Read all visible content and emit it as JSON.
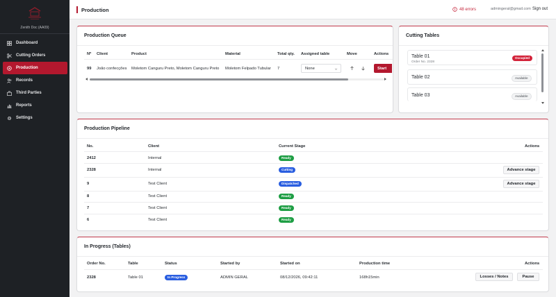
{
  "sidebar": {
    "org": "Zenith Doc (AA09)",
    "items": [
      {
        "label": "Dashboard",
        "icon": "grid-icon"
      },
      {
        "label": "Cutting Orders",
        "icon": "scissors-icon"
      },
      {
        "label": "Production",
        "icon": "production-icon"
      },
      {
        "label": "Records",
        "icon": "users-icon"
      },
      {
        "label": "Third Parties",
        "icon": "briefcase-icon"
      },
      {
        "label": "Reports",
        "icon": "chart-icon"
      },
      {
        "label": "Settings",
        "icon": "gear-icon"
      }
    ]
  },
  "header": {
    "title": "Production",
    "errors": "48 errors",
    "email": "admingeral@gmail.com",
    "signout": "Sign out"
  },
  "queue": {
    "title": "Production Queue",
    "columns": [
      "Nº",
      "Client",
      "Product",
      "Material",
      "Total qty.",
      "Assigned table",
      "Move",
      "Actions"
    ],
    "row": {
      "no": "99",
      "client": "João confecções",
      "product": "Moletom Canguru Preto, Moletom Canguru Preto",
      "material": "Moletom Felpado Tubular",
      "qty": "7",
      "table": "None",
      "action": "Start"
    }
  },
  "tables": {
    "title": "Cutting Tables",
    "items": [
      {
        "name": "Table 01",
        "order": "Order No. 2328",
        "status": "Occupied"
      },
      {
        "name": "Table 02",
        "order": "",
        "status": "Available"
      },
      {
        "name": "Table 03",
        "order": "",
        "status": "Available"
      }
    ]
  },
  "pipeline": {
    "title": "Production Pipeline",
    "columns": [
      "No.",
      "Client",
      "Current Stage",
      "Actions"
    ],
    "rows": [
      {
        "no": "2412",
        "client": "Internal",
        "stage": "Ready",
        "action": ""
      },
      {
        "no": "2328",
        "client": "Internal",
        "stage": "Cutting",
        "action": "Advance stage"
      },
      {
        "no": "9",
        "client": "Test Client",
        "stage": "Dispatched",
        "action": "Advance stage"
      },
      {
        "no": "8",
        "client": "Test Client",
        "stage": "Ready",
        "action": ""
      },
      {
        "no": "7",
        "client": "Test Client",
        "stage": "Ready",
        "action": ""
      },
      {
        "no": "6",
        "client": "Test Client",
        "stage": "Ready",
        "action": ""
      }
    ]
  },
  "progress": {
    "title": "In Progress (Tables)",
    "columns": [
      "Order No.",
      "Table",
      "Status",
      "Started by",
      "Started on",
      "Production time",
      "Actions"
    ],
    "row": {
      "order": "2328",
      "table": "Table 01",
      "status": "In Progress",
      "by": "ADMIN GERAL",
      "on": "08/12/2026, 09:42:11",
      "time": "168h15min",
      "btn1": "Losses / Notes",
      "btn2": "Pause"
    }
  },
  "colors": {
    "brand": "#b3182e",
    "sidebar": "#1e2125",
    "ready": "#1e9e44",
    "cutting": "#2a5ee0"
  }
}
